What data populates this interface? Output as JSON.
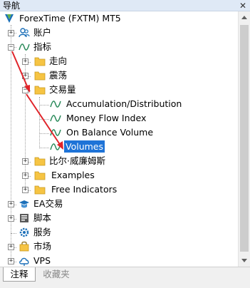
{
  "panel": {
    "title": "导航",
    "close_glyph": "✕"
  },
  "tree": {
    "root": "ForexTime (FXTM) MT5",
    "accounts": "账户",
    "indicators": "指标",
    "trend": "走向",
    "oscillators": "震荡",
    "volumes_folder": "交易量",
    "accumulation": "Accumulation/Distribution",
    "mfi": "Money Flow Index",
    "obv": "On Balance Volume",
    "volumes": "Volumes",
    "bill_williams": "比尔·威廉姆斯",
    "examples": "Examples",
    "free_indicators": "Free Indicators",
    "ea": "EA交易",
    "scripts": "脚本",
    "services": "服务",
    "market": "市场",
    "vps": "VPS"
  },
  "tabs": {
    "common": "注释",
    "favorites": "收藏夹"
  },
  "colors": {
    "selection": "#1e73d7",
    "arrow": "#e0242a",
    "folder": "#f6c443",
    "indicator_icon": "#2a8a5a"
  }
}
